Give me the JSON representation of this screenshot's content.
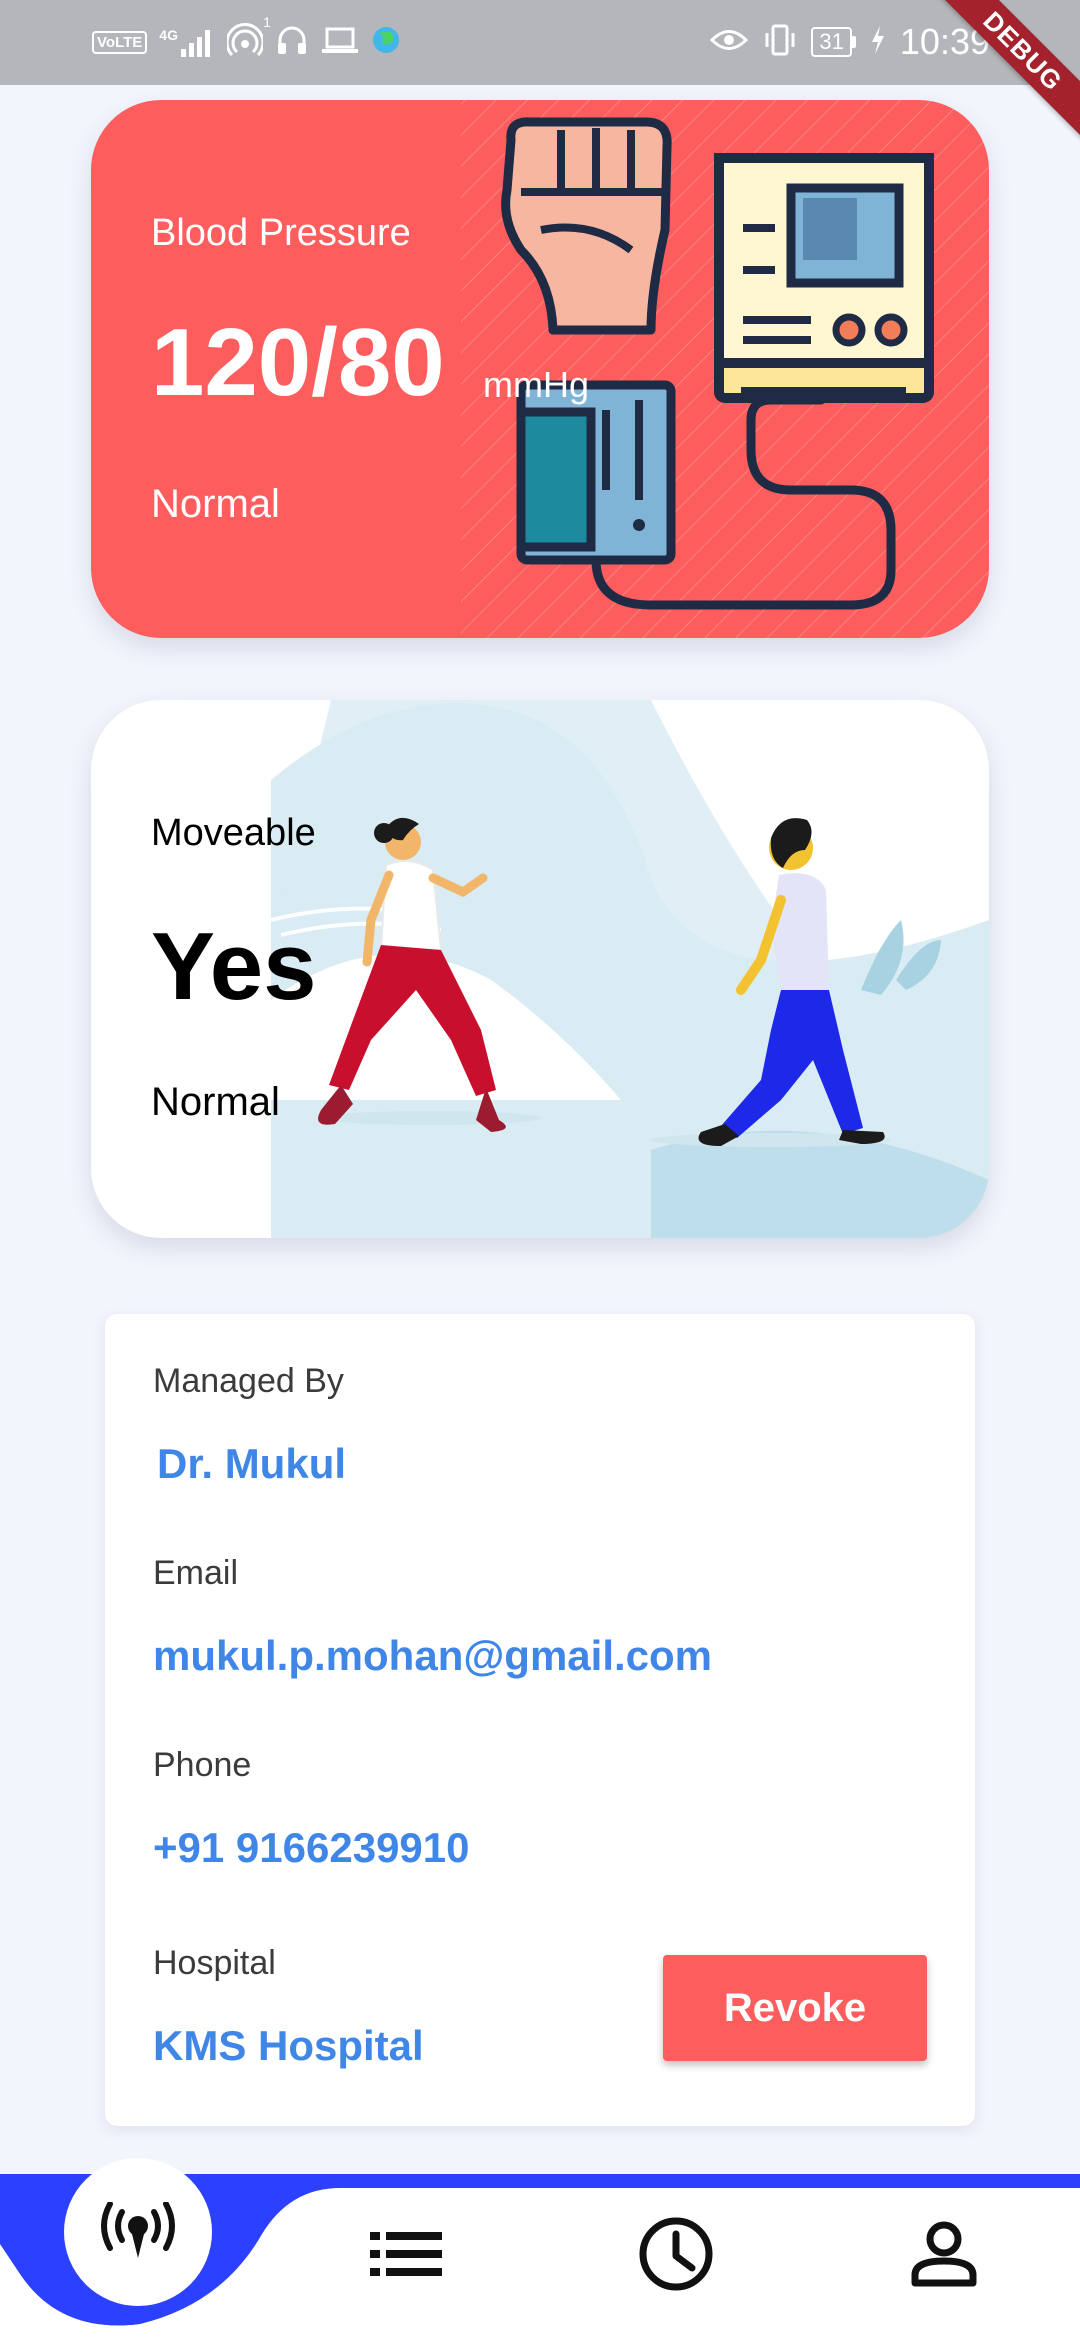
{
  "status_bar": {
    "network_badge": "VoLTE",
    "network_type": "4G",
    "hotspot_count": "1",
    "battery": "31",
    "time": "10:39",
    "debug_label": "DEBUG",
    "icons": [
      "volte-icon",
      "signal-icon",
      "hotspot-icon",
      "headset-icon",
      "laptop-icon",
      "app-globe-icon",
      "eye-comfort-icon",
      "vibrate-icon",
      "battery-icon",
      "charging-icon"
    ]
  },
  "blood_pressure_card": {
    "label": "Blood Pressure",
    "value": "120/80",
    "unit": "mmHg",
    "status": "Normal",
    "background": "#fd5d5d",
    "illustration": "blood-pressure-monitor-illustration"
  },
  "mobility_card": {
    "label": "Moveable",
    "value": "Yes",
    "status": "Normal",
    "background": "#ffffff",
    "illustration": "walking-people-illustration"
  },
  "manager_info": {
    "managed_by_label": "Managed By",
    "managed_by": "Dr. Mukul",
    "email_label": "Email",
    "email": "mukul.p.mohan@gmail.com",
    "phone_label": "Phone",
    "phone": "+91 9166239910",
    "hospital_label": "Hospital",
    "hospital": "KMS Hospital",
    "revoke_label": "Revoke",
    "value_color": "#3f86e6",
    "button_color": "#fd5d5d"
  },
  "bottom_nav": {
    "accent": "#2b41ff",
    "items": [
      {
        "icon": "broadcast-icon",
        "active": true
      },
      {
        "icon": "list-icon",
        "active": false
      },
      {
        "icon": "clock-icon",
        "active": false
      },
      {
        "icon": "person-icon",
        "active": false
      }
    ]
  }
}
